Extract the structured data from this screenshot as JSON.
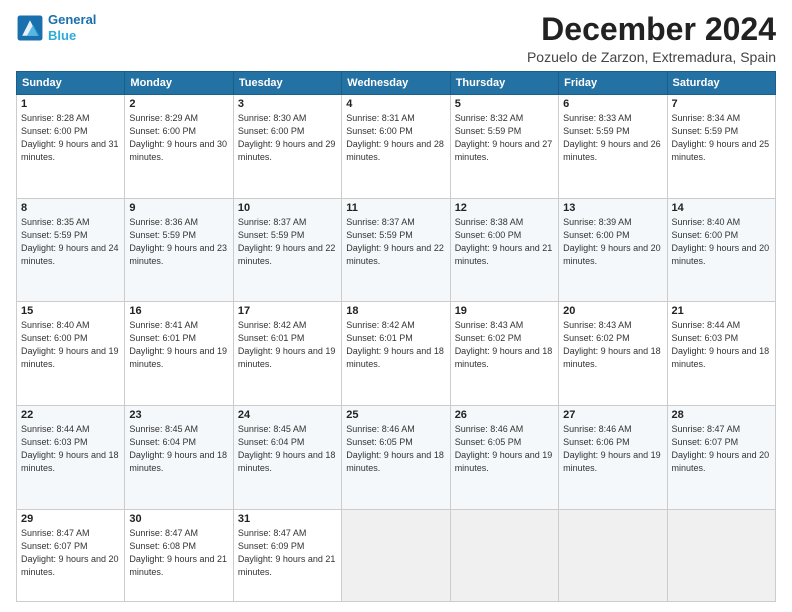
{
  "logo": {
    "line1": "General",
    "line2": "Blue"
  },
  "title": "December 2024",
  "subtitle": "Pozuelo de Zarzon, Extremadura, Spain",
  "weekdays": [
    "Sunday",
    "Monday",
    "Tuesday",
    "Wednesday",
    "Thursday",
    "Friday",
    "Saturday"
  ],
  "weeks": [
    [
      {
        "day": "1",
        "rise": "8:28 AM",
        "set": "6:00 PM",
        "daylight": "9 hours and 31 minutes."
      },
      {
        "day": "2",
        "rise": "8:29 AM",
        "set": "6:00 PM",
        "daylight": "9 hours and 30 minutes."
      },
      {
        "day": "3",
        "rise": "8:30 AM",
        "set": "6:00 PM",
        "daylight": "9 hours and 29 minutes."
      },
      {
        "day": "4",
        "rise": "8:31 AM",
        "set": "6:00 PM",
        "daylight": "9 hours and 28 minutes."
      },
      {
        "day": "5",
        "rise": "8:32 AM",
        "set": "5:59 PM",
        "daylight": "9 hours and 27 minutes."
      },
      {
        "day": "6",
        "rise": "8:33 AM",
        "set": "5:59 PM",
        "daylight": "9 hours and 26 minutes."
      },
      {
        "day": "7",
        "rise": "8:34 AM",
        "set": "5:59 PM",
        "daylight": "9 hours and 25 minutes."
      }
    ],
    [
      {
        "day": "8",
        "rise": "8:35 AM",
        "set": "5:59 PM",
        "daylight": "9 hours and 24 minutes."
      },
      {
        "day": "9",
        "rise": "8:36 AM",
        "set": "5:59 PM",
        "daylight": "9 hours and 23 minutes."
      },
      {
        "day": "10",
        "rise": "8:37 AM",
        "set": "5:59 PM",
        "daylight": "9 hours and 22 minutes."
      },
      {
        "day": "11",
        "rise": "8:37 AM",
        "set": "5:59 PM",
        "daylight": "9 hours and 22 minutes."
      },
      {
        "day": "12",
        "rise": "8:38 AM",
        "set": "6:00 PM",
        "daylight": "9 hours and 21 minutes."
      },
      {
        "day": "13",
        "rise": "8:39 AM",
        "set": "6:00 PM",
        "daylight": "9 hours and 20 minutes."
      },
      {
        "day": "14",
        "rise": "8:40 AM",
        "set": "6:00 PM",
        "daylight": "9 hours and 20 minutes."
      }
    ],
    [
      {
        "day": "15",
        "rise": "8:40 AM",
        "set": "6:00 PM",
        "daylight": "9 hours and 19 minutes."
      },
      {
        "day": "16",
        "rise": "8:41 AM",
        "set": "6:01 PM",
        "daylight": "9 hours and 19 minutes."
      },
      {
        "day": "17",
        "rise": "8:42 AM",
        "set": "6:01 PM",
        "daylight": "9 hours and 19 minutes."
      },
      {
        "day": "18",
        "rise": "8:42 AM",
        "set": "6:01 PM",
        "daylight": "9 hours and 18 minutes."
      },
      {
        "day": "19",
        "rise": "8:43 AM",
        "set": "6:02 PM",
        "daylight": "9 hours and 18 minutes."
      },
      {
        "day": "20",
        "rise": "8:43 AM",
        "set": "6:02 PM",
        "daylight": "9 hours and 18 minutes."
      },
      {
        "day": "21",
        "rise": "8:44 AM",
        "set": "6:03 PM",
        "daylight": "9 hours and 18 minutes."
      }
    ],
    [
      {
        "day": "22",
        "rise": "8:44 AM",
        "set": "6:03 PM",
        "daylight": "9 hours and 18 minutes."
      },
      {
        "day": "23",
        "rise": "8:45 AM",
        "set": "6:04 PM",
        "daylight": "9 hours and 18 minutes."
      },
      {
        "day": "24",
        "rise": "8:45 AM",
        "set": "6:04 PM",
        "daylight": "9 hours and 18 minutes."
      },
      {
        "day": "25",
        "rise": "8:46 AM",
        "set": "6:05 PM",
        "daylight": "9 hours and 18 minutes."
      },
      {
        "day": "26",
        "rise": "8:46 AM",
        "set": "6:05 PM",
        "daylight": "9 hours and 19 minutes."
      },
      {
        "day": "27",
        "rise": "8:46 AM",
        "set": "6:06 PM",
        "daylight": "9 hours and 19 minutes."
      },
      {
        "day": "28",
        "rise": "8:47 AM",
        "set": "6:07 PM",
        "daylight": "9 hours and 20 minutes."
      }
    ],
    [
      {
        "day": "29",
        "rise": "8:47 AM",
        "set": "6:07 PM",
        "daylight": "9 hours and 20 minutes."
      },
      {
        "day": "30",
        "rise": "8:47 AM",
        "set": "6:08 PM",
        "daylight": "9 hours and 21 minutes."
      },
      {
        "day": "31",
        "rise": "8:47 AM",
        "set": "6:09 PM",
        "daylight": "9 hours and 21 minutes."
      },
      null,
      null,
      null,
      null
    ]
  ]
}
